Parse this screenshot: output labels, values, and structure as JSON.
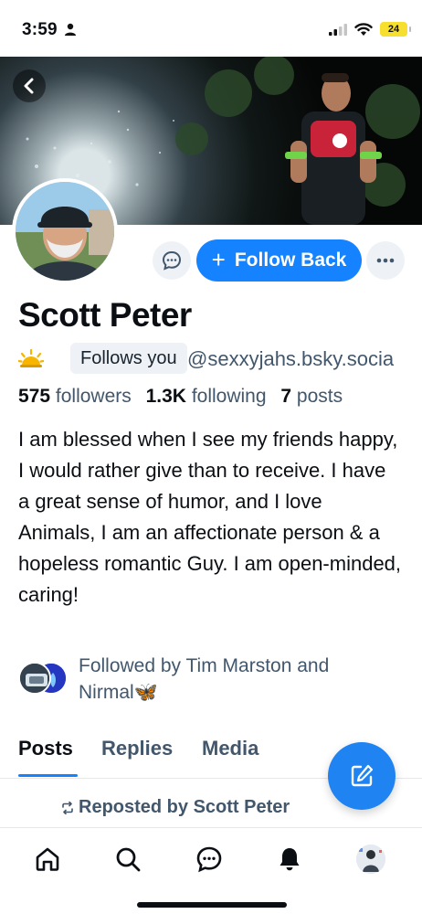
{
  "status_bar": {
    "time": "3:59",
    "battery": "24"
  },
  "profile": {
    "name": "Scott Peter",
    "follows_you_badge": "Follows you",
    "handle": "@sexxyjahs.bsky.socia",
    "followers_count": "575",
    "followers_label": "followers",
    "following_count": "1.3K",
    "following_label": "following",
    "posts_count": "7",
    "posts_label": "posts",
    "bio": "I am blessed when I see my friends happy, I would rather give than to receive. I have a great sense of humor, and I love Animals, I am an affectionate person & a hopeless romantic Guy. I am open-minded, caring!",
    "followed_by_line1": "Followed by Tim Marston and",
    "followed_by_line2": "Nirmal🦋"
  },
  "actions": {
    "follow_back": "Follow Back"
  },
  "tabs": [
    {
      "label": "Posts",
      "active": true
    },
    {
      "label": "Replies",
      "active": false
    },
    {
      "label": "Media",
      "active": false
    }
  ],
  "feed": {
    "repost_label": "Reposted by Scott Peter"
  },
  "nav": [
    "home-icon",
    "search-icon",
    "chat-icon",
    "bell-icon",
    "profile-avatar"
  ],
  "colors": {
    "accent": "#1582ff",
    "muted_text": "#42576c",
    "fab": "#1f83f2"
  }
}
